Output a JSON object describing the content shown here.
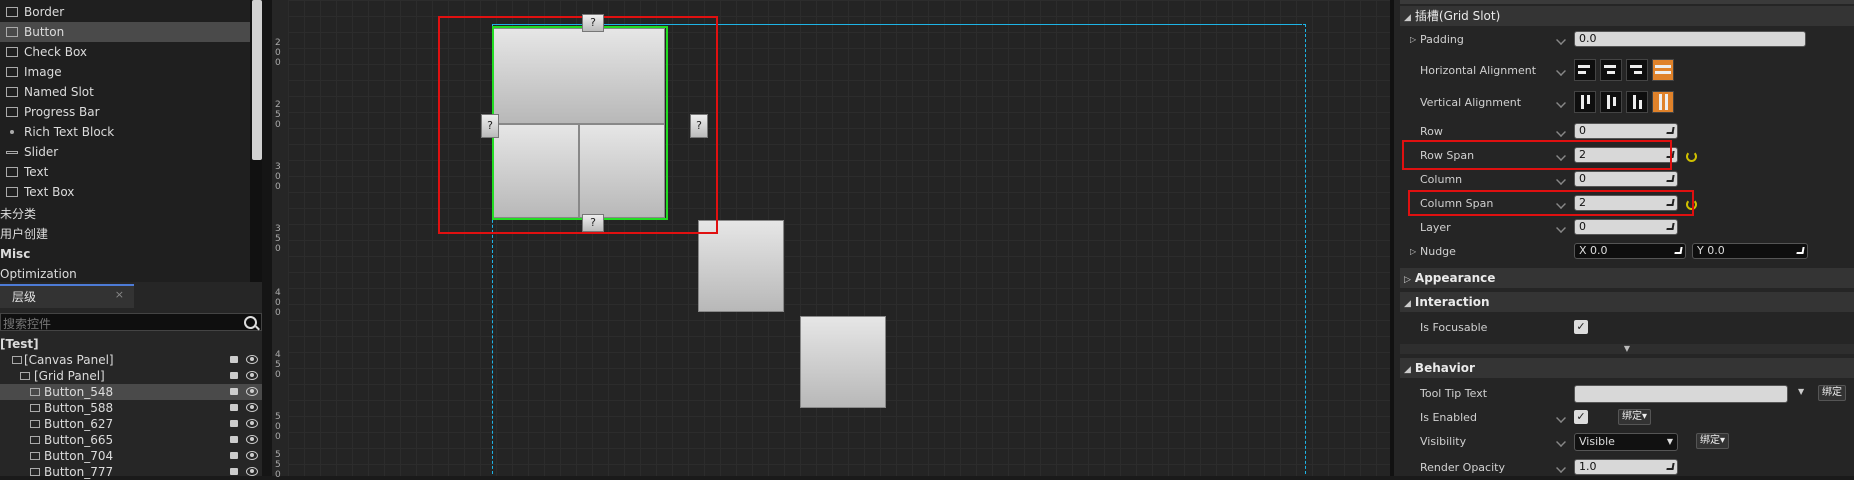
{
  "palette": {
    "items": [
      {
        "label": "Border",
        "icon": "border-icon",
        "selected": false
      },
      {
        "label": "Button",
        "icon": "button-icon",
        "selected": true
      },
      {
        "label": "Check Box",
        "icon": "checkbox-icon",
        "selected": false
      },
      {
        "label": "Image",
        "icon": "image-icon",
        "selected": false
      },
      {
        "label": "Named Slot",
        "icon": "named-slot-icon",
        "selected": false
      },
      {
        "label": "Progress Bar",
        "icon": "progress-bar-icon",
        "selected": false
      },
      {
        "label": "Rich Text Block",
        "icon": "rich-text-icon",
        "selected": false
      },
      {
        "label": "Slider",
        "icon": "slider-icon",
        "selected": false
      },
      {
        "label": "Text",
        "icon": "text-icon",
        "selected": false
      },
      {
        "label": "Text Box",
        "icon": "text-box-icon",
        "selected": false
      }
    ],
    "categories": [
      "未分类",
      "用户创建",
      "Misc",
      "Optimization"
    ]
  },
  "hierarchy": {
    "tab_label": "层级",
    "tab_close": "×",
    "search_placeholder": "搜索控件",
    "root": "[Test]",
    "canvas_panel": "[Canvas Panel]",
    "grid_panel": "[Grid Panel]",
    "buttons": [
      "Button_548",
      "Button_588",
      "Button_627",
      "Button_665",
      "Button_704",
      "Button_777"
    ],
    "selected": "Button_548"
  },
  "ruler": {
    "ticks": [
      "2",
      "0",
      "0",
      "2",
      "5",
      "0",
      "3",
      "0",
      "0",
      "3",
      "5",
      "0",
      "4",
      "0",
      "0",
      "4",
      "5",
      "0",
      "5",
      "0",
      "0",
      "5",
      "5",
      "0"
    ]
  },
  "canvas": {
    "handle_label": "?"
  },
  "details": {
    "grid_slot_header": "插槽(Grid Slot)",
    "padding_label": "Padding",
    "padding_value": "0.0",
    "halign_label": "Horizontal Alignment",
    "valign_label": "Vertical Alignment",
    "row_label": "Row",
    "row_value": "0",
    "row_span_label": "Row Span",
    "row_span_value": "2",
    "column_label": "Column",
    "column_value": "0",
    "column_span_label": "Column Span",
    "column_span_value": "2",
    "layer_label": "Layer",
    "layer_value": "0",
    "nudge_label": "Nudge",
    "nudge_x": "X  0.0",
    "nudge_y": "Y  0.0",
    "appearance_header": "Appearance",
    "interaction_header": "Interaction",
    "is_focusable_label": "Is Focusable",
    "behavior_header": "Behavior",
    "tooltip_label": "Tool Tip Text",
    "tooltip_bind": "绑定",
    "is_enabled_label": "Is Enabled",
    "bind_label": "绑定▾",
    "visibility_label": "Visibility",
    "visibility_value": "Visible",
    "render_opacity_label": "Render Opacity",
    "render_opacity_value": "1.0",
    "checkmark": "✓"
  },
  "colors": {
    "highlight_red": "#e01010",
    "selection_green": "#22dd22",
    "bounds_cyan": "#1eb4e6",
    "active_orange": "#e0822a"
  }
}
